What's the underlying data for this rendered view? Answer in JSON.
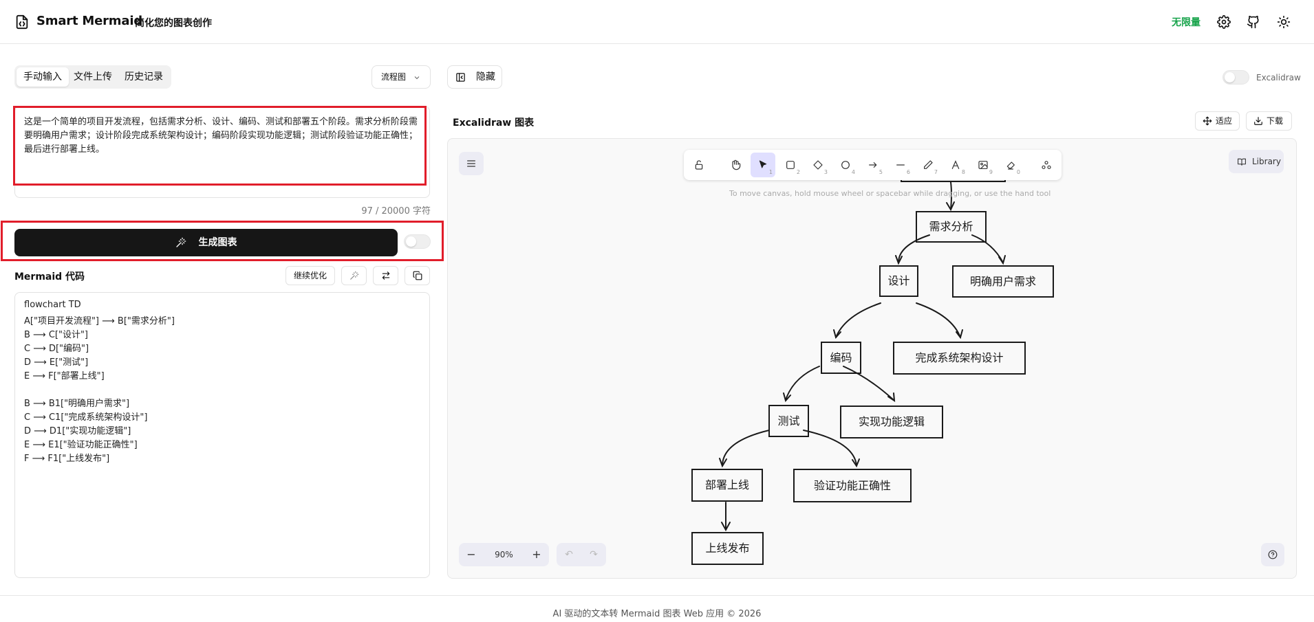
{
  "header": {
    "title": "Smart Mermaid",
    "subtitle": "简化您的图表创作",
    "quota": "无限量",
    "quota_color": "#16a34a",
    "icons": [
      "settings-icon",
      "github-icon",
      "theme-sun-icon"
    ]
  },
  "input": {
    "tabs": [
      "手动输入",
      "文件上传",
      "历史记录"
    ],
    "active_tab": "手动输入",
    "diagram_type": "流程图",
    "prompt": "这是一个简单的项目开发流程，包括需求分析、设计、编码、测试和部署五个阶段。需求分析阶段需要明确用户需求；设计阶段完成系统架构设计；编码阶段实现功能逻辑；测试阶段验证功能正确性；最后进行部署上线。",
    "char_count": "97 / 20000 字符",
    "generate_label": "生成图表",
    "toggle_on": false
  },
  "code": {
    "label": "Mermaid 代码",
    "optimize_label": "继续优化",
    "lines": [
      "flowchart TD",
      "A[\"项目开发流程\"] ⟶ B[\"需求分析\"]",
      "B ⟶ C[\"设计\"]",
      "C ⟶ D[\"编码\"]",
      "D ⟶ E[\"测试\"]",
      "E ⟶ F[\"部署上线\"]",
      "",
      "B ⟶ B1[\"明确用户需求\"]",
      "C ⟶ C1[\"完成系统架构设计\"]",
      "D ⟶ D1[\"实现功能逻辑\"]",
      "E ⟶ E1[\"验证功能正确性\"]",
      "F ⟶ F1[\"上线发布\"]"
    ]
  },
  "preview": {
    "hide_label": "隐藏",
    "switch_label": "Excalidraw",
    "title": "Excalidraw 图表",
    "fit_label": "适应",
    "download_label": "下载",
    "library_label": "Library",
    "hint": "To move canvas, hold mouse wheel or spacebar while dragging, or use the hand tool",
    "zoom": "90%",
    "tool_numbers": [
      "1",
      "2",
      "3",
      "4",
      "5",
      "6",
      "7",
      "8",
      "9",
      "0"
    ],
    "nodes": {
      "b": "需求分析",
      "c": "设计",
      "b1": "明确用户需求",
      "d": "编码",
      "c1": "完成系统架构设计",
      "e": "测试",
      "d1": "实现功能逻辑",
      "f": "部署上线",
      "e1": "验证功能正确性",
      "f1": "上线发布"
    }
  },
  "footer": {
    "text": "AI 驱动的文本转 Mermaid 图表 Web 应用 © 2026"
  }
}
